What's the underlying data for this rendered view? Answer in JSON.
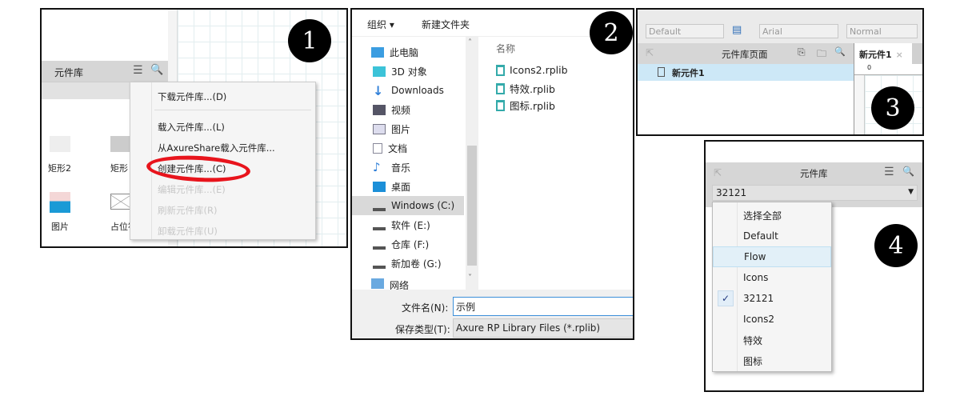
{
  "panel1": {
    "badge": "1",
    "library_title": "元件库",
    "widgets": [
      "矩形2",
      "矩形",
      "图片",
      "占位符"
    ],
    "menu": [
      "下载元件库...(D)",
      "载入元件库...(L)",
      "从AxureShare载入元件库...",
      "创建元件库...(C)",
      "编辑元件库...(E)",
      "刷新元件库(R)",
      "卸载元件库(U)"
    ],
    "highlight_color": "#e8141c"
  },
  "panel2": {
    "badge": "2",
    "toolbar": {
      "organize": "组织 ▾",
      "new_folder": "新建文件夹"
    },
    "nav": [
      "此电脑",
      "3D 对象",
      "Downloads",
      "视频",
      "图片",
      "文档",
      "音乐",
      "桌面",
      "Windows (C:)",
      "软件 (E:)",
      "仓库 (F:)",
      "新加卷 (G:)",
      "网络"
    ],
    "selected_nav": "Windows (C:)",
    "column": "名称",
    "files": [
      "Icons2.rplib",
      "特效.rplib",
      "图标.rplib"
    ],
    "filename_label": "文件名(N):",
    "filename_value": "示例",
    "filetype_label": "保存类型(T):",
    "filetype_value": "Axure RP Library Files (*.rplib)"
  },
  "panel3": {
    "badge": "3",
    "style_select": "Default",
    "font_select": "Arial",
    "weight_select": "Normal",
    "pages_title": "元件库页面",
    "page_item": "新元件1",
    "tab": "新元件1",
    "ruler_zero": "0"
  },
  "panel4": {
    "badge": "4",
    "title": "元件库",
    "selected": "32121",
    "options": [
      "选择全部",
      "Default",
      "Flow",
      "Icons",
      "32121",
      "Icons2",
      "特效",
      "图标"
    ],
    "hovered": "Flow",
    "checked": "32121"
  }
}
